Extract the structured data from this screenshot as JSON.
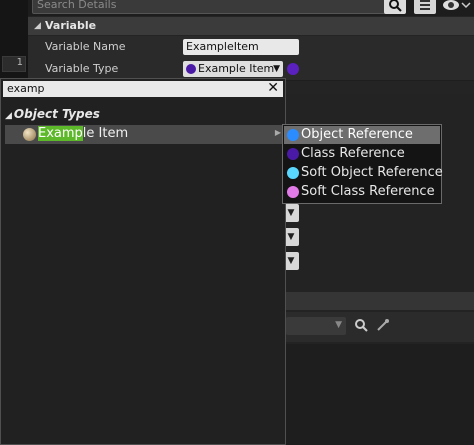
{
  "details": {
    "search_placeholder": "Search Details",
    "left_tab_label": "1",
    "category": "Variable",
    "rows": [
      {
        "label": "Variable Name",
        "value": "ExampleItem"
      },
      {
        "label": "Variable Type",
        "value": "Example Item"
      }
    ]
  },
  "picker": {
    "search_value": "examp",
    "clear_glyph": "✕",
    "category": "Object Types",
    "item": {
      "match": "Examp",
      "rest": "le Item",
      "icon": "object-ball-icon"
    }
  },
  "submenu": {
    "items": [
      {
        "label": "Object Reference",
        "color": "#2a8cff",
        "selected": true
      },
      {
        "label": "Class Reference",
        "color": "#4a1aa6",
        "selected": false
      },
      {
        "label": "Soft Object Reference",
        "color": "#5ad7ff",
        "selected": false
      },
      {
        "label": "Soft Class Reference",
        "color": "#e07be8",
        "selected": false
      }
    ]
  },
  "colors": {
    "highlight": "#5db82a",
    "object_pin": "#4a1aa6"
  }
}
